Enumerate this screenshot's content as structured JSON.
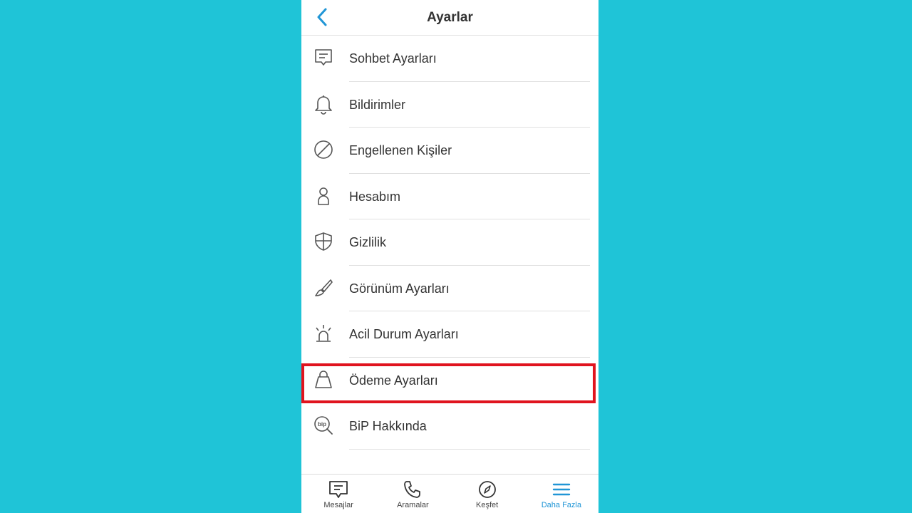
{
  "colors": {
    "background": "#1fc4d7",
    "accent": "#2196d6",
    "highlight": "#e0141e",
    "text": "#333333"
  },
  "header": {
    "title": "Ayarlar",
    "back_icon": "chevron-left-icon"
  },
  "menu": {
    "items": [
      {
        "label": "Sohbet Ayarları",
        "icon": "chat-settings-icon"
      },
      {
        "label": "Bildirimler",
        "icon": "bell-icon"
      },
      {
        "label": "Engellenen Kişiler",
        "icon": "blocked-icon"
      },
      {
        "label": "Hesabım",
        "icon": "person-icon"
      },
      {
        "label": "Gizlilik",
        "icon": "shield-icon"
      },
      {
        "label": "Görünüm Ayarları",
        "icon": "brush-icon"
      },
      {
        "label": "Acil Durum Ayarları",
        "icon": "siren-icon"
      },
      {
        "label": "Ödeme Ayarları",
        "icon": "bag-icon"
      },
      {
        "label": "BiP Hakkında",
        "icon": "bip-icon"
      }
    ],
    "highlighted_index": 7
  },
  "tabbar": {
    "tabs": [
      {
        "label": "Mesajlar",
        "icon": "message-icon"
      },
      {
        "label": "Aramalar",
        "icon": "phone-icon"
      },
      {
        "label": "Keşfet",
        "icon": "compass-icon"
      },
      {
        "label": "Daha Fazla",
        "icon": "menu-icon",
        "active": true
      }
    ]
  }
}
